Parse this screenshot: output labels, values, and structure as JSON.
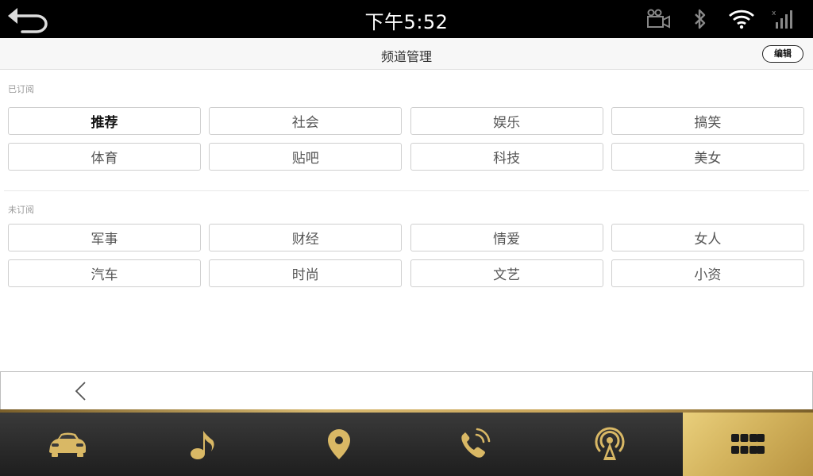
{
  "status_bar": {
    "time": "下午5:52",
    "icons": [
      "video-camera-icon",
      "bluetooth-icon",
      "wifi-icon",
      "cellular-signal-icon"
    ]
  },
  "header": {
    "title": "频道管理",
    "edit_label": "编辑"
  },
  "subscribed": {
    "label": "已订阅",
    "items": [
      "推荐",
      "社会",
      "娱乐",
      "搞笑",
      "体育",
      "贴吧",
      "科技",
      "美女"
    ],
    "active_index": 0
  },
  "unsubscribed": {
    "label": "未订阅",
    "items": [
      "军事",
      "财经",
      "情爱",
      "女人",
      "汽车",
      "时尚",
      "文艺",
      "小资"
    ]
  },
  "dock": {
    "items": [
      "car-icon",
      "music-note-icon",
      "location-pin-icon",
      "phone-icon",
      "radio-antenna-icon",
      "apps-grid-icon"
    ],
    "active_index": 5
  },
  "colors": {
    "accent_gold": "#d4b45e",
    "dock_icon": "#d9b865"
  }
}
